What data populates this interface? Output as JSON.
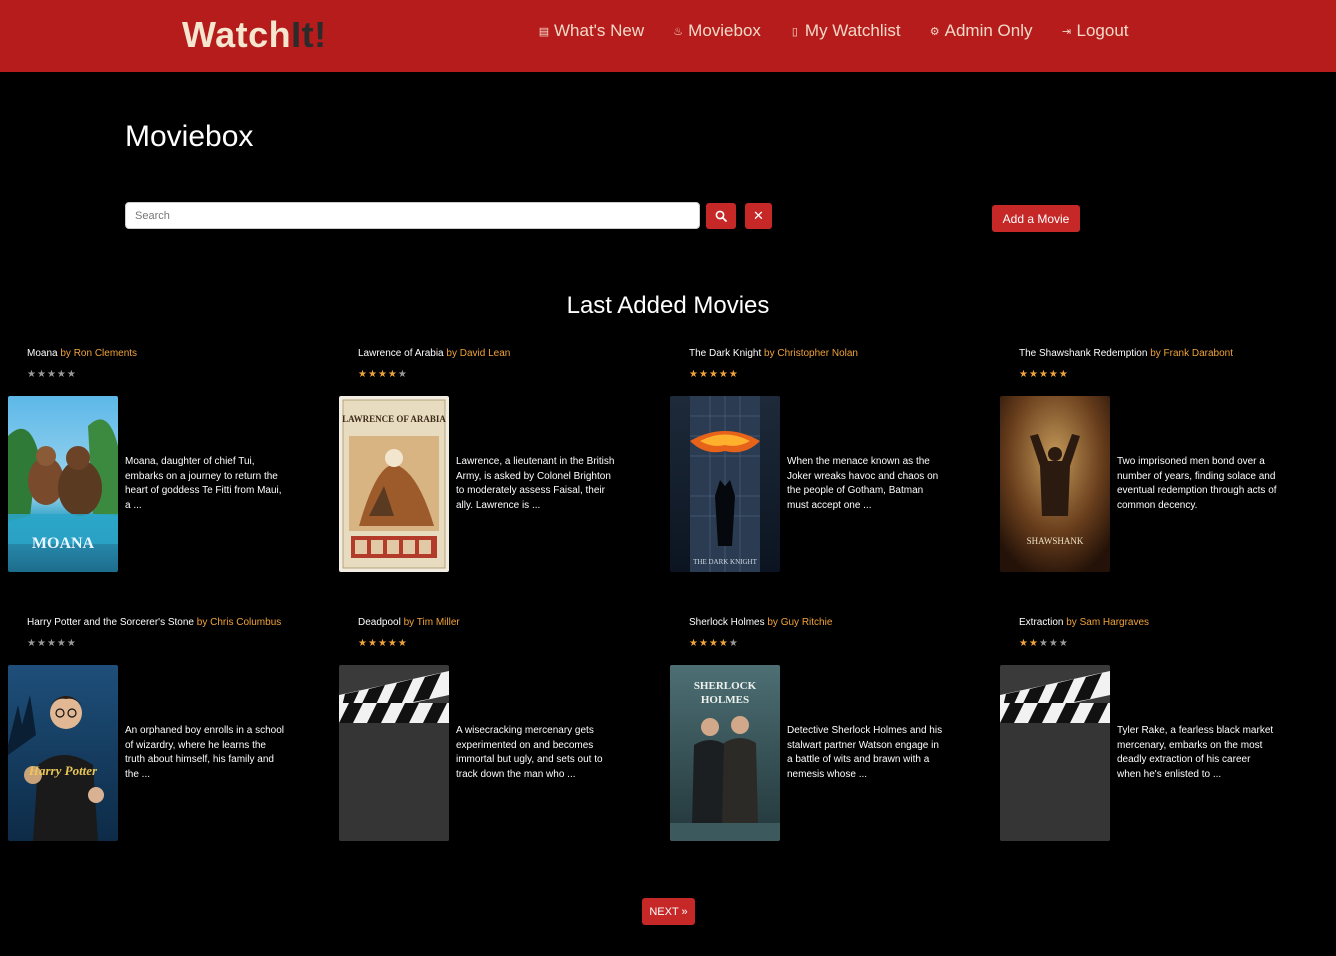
{
  "brand": {
    "part1": "Watch",
    "part2": "It!"
  },
  "nav": [
    {
      "icon": "film-icon",
      "glyph": "▤",
      "label": "What's New"
    },
    {
      "icon": "fire-icon",
      "glyph": "♨",
      "label": "Moviebox"
    },
    {
      "icon": "bookmark-icon",
      "glyph": "▯",
      "label": "My Watchlist"
    },
    {
      "icon": "gears-icon",
      "glyph": "⚙",
      "label": "Admin Only"
    },
    {
      "icon": "logout-icon",
      "glyph": "⇥",
      "label": "Logout"
    }
  ],
  "page_title": "Moviebox",
  "search": {
    "placeholder": "Search",
    "value": ""
  },
  "buttons": {
    "clear": "✕",
    "add_movie": "Add a Movie",
    "next": "NEXT »"
  },
  "section_title": "Last Added Movies",
  "movies": [
    {
      "title": "Moana",
      "director": "by Ron Clements",
      "rating": 0,
      "description": "Moana, daughter of chief Tui, embarks on a journey to return the heart of goddess Te Fitti from Maui, a ...",
      "poster": "moana-poster"
    },
    {
      "title": "Lawrence of Arabia",
      "director": "by David Lean",
      "rating": 4,
      "description": "Lawrence, a lieutenant in the British Army, is asked by Colonel Brighton to moderately assess Faisal, their ally. Lawrence is ...",
      "poster": "lawrence-poster"
    },
    {
      "title": "The Dark Knight",
      "director": "by Christopher Nolan",
      "rating": 5,
      "description": "When the menace known as the Joker wreaks havoc and chaos on the people of Gotham, Batman must accept one ...",
      "poster": "dark-knight-poster"
    },
    {
      "title": "The Shawshank Redemption",
      "director": "by Frank Darabont",
      "rating": 5,
      "description": "Two imprisoned men bond over a number of years, finding solace and eventual redemption through acts of common decency.",
      "poster": "shawshank-poster"
    },
    {
      "title": "Harry Potter and the Sorcerer's Stone",
      "director": "by Chris Columbus",
      "rating": 0,
      "description": "An orphaned boy enrolls in a school of wizardry, where he learns the truth about himself, his family and the ...",
      "poster": "harry-potter-poster"
    },
    {
      "title": "Deadpool",
      "director": "by Tim Miller",
      "rating": 5,
      "description": "A wisecracking mercenary gets experimented on and becomes immortal but ugly, and sets out to track down the man who ...",
      "poster": "clapperboard-placeholder"
    },
    {
      "title": "Sherlock Holmes",
      "director": "by Guy Ritchie",
      "rating": 4,
      "description": "Detective Sherlock Holmes and his stalwart partner Watson engage in a battle of wits and brawn with a nemesis whose ...",
      "poster": "sherlock-poster"
    },
    {
      "title": "Extraction",
      "director": "by Sam Hargraves",
      "rating": 2,
      "description": "Tyler Rake, a fearless black market mercenary, embarks on the most deadly extraction of his career when he's enlisted to ...",
      "poster": "clapperboard-placeholder"
    }
  ],
  "poster_texts": {
    "lawrence": "LAWRENCE OF ARABIA",
    "moana": "MOANA",
    "dark_knight": "THE DARK KNIGHT",
    "shawshank": "SHAWSHANK",
    "harry_potter": "Harry Potter",
    "sherlock": "SHERLOCK HOLMES"
  },
  "colors": {
    "navbar": "#b71c1c",
    "accent_red": "#c62828",
    "director_orange": "#f0a33a",
    "star_off": "#999999",
    "background": "#000000"
  }
}
